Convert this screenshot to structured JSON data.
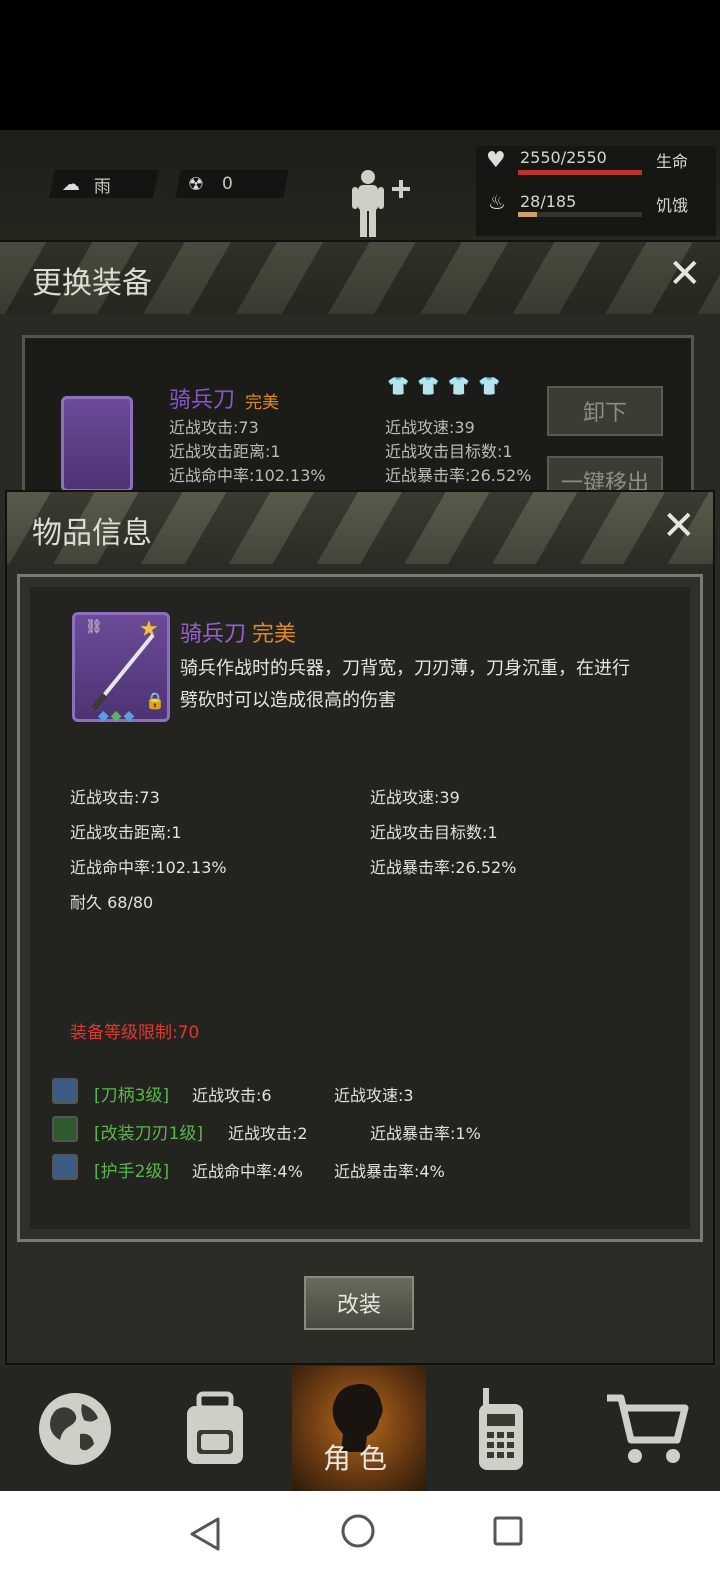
{
  "hud": {
    "weather": "雨",
    "radiation": "0",
    "health_value": "2550/2550",
    "health_label": "生命",
    "hunger_value": "28/185",
    "hunger_label": "饥饿"
  },
  "equip_panel": {
    "title": "更换装备",
    "item_name": "骑兵刀",
    "item_quality": "完美",
    "stats": [
      "近战攻击:73",
      "近战攻速:39",
      "近战攻击距离:1",
      "近战攻击目标数:1",
      "近战命中率:102.13%",
      "近战暴击率:26.52%"
    ],
    "unequip_label": "卸下",
    "remove_all_label": "一键移出"
  },
  "item_info": {
    "title": "物品信息",
    "name": "骑兵刀",
    "quality": "完美",
    "description_line1": "骑兵作战时的兵器，刀背宽，刀刃薄，刀身沉重，在进行",
    "description_line2": "劈砍时可以造成很高的伤害",
    "stats_left": [
      "近战攻击:73",
      "近战攻击距离:1",
      "近战命中率:102.13%",
      "耐久 68/80"
    ],
    "stats_right": [
      "近战攻速:39",
      "近战攻击目标数:1",
      "近战暴击率:26.52%"
    ],
    "level_requirement": "装备等级限制:70",
    "mods": [
      {
        "name": "[刀柄3级]",
        "stat1": "近战攻击:6",
        "stat2": "近战攻速:3"
      },
      {
        "name": "[改装刀刃1级]",
        "stat1": "近战攻击:2",
        "stat2": "近战暴击率:1%"
      },
      {
        "name": "[护手2级]",
        "stat1": "近战命中率:4%",
        "stat2": "近战暴击率:4%"
      }
    ],
    "modify_label": "改装"
  },
  "nav": {
    "active_label": "角色"
  },
  "colors": {
    "quality_orange": "#e08a1e",
    "item_purple": "#9a5fd0",
    "requirement_red": "#e0382e",
    "mod_green": "#58b848"
  }
}
